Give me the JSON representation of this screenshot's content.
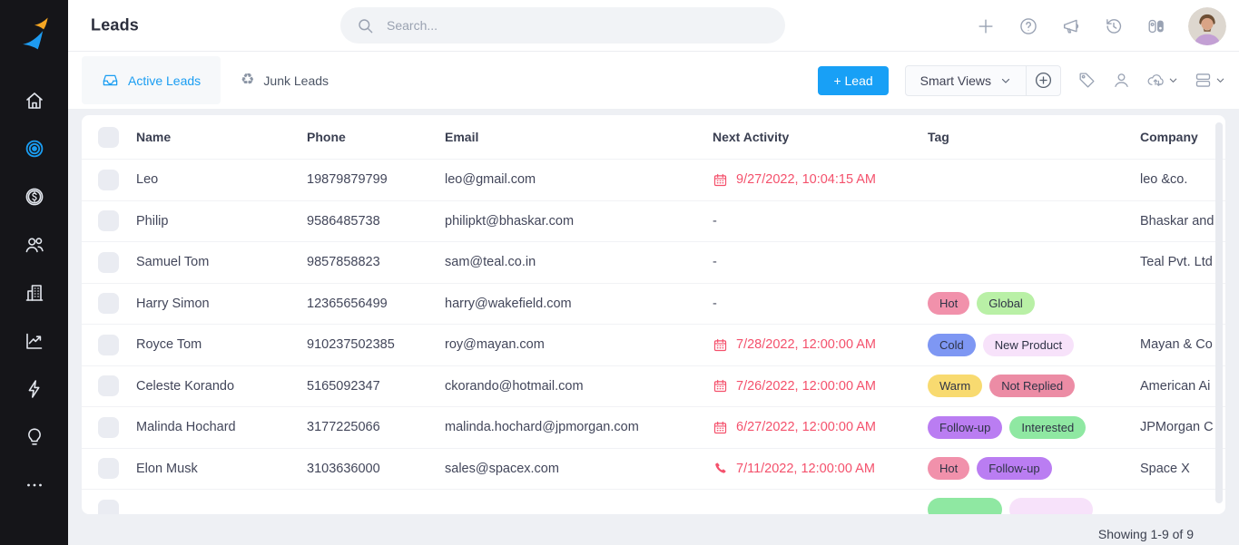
{
  "header": {
    "title": "Leads"
  },
  "search": {
    "placeholder": "Search..."
  },
  "topbar_icons": [
    {
      "name": "add-icon",
      "icon": "plus"
    },
    {
      "name": "help-icon",
      "icon": "help"
    },
    {
      "name": "announcements-icon",
      "icon": "megaphone"
    },
    {
      "name": "history-icon",
      "icon": "history"
    },
    {
      "name": "apps-icon",
      "icon": "apps"
    }
  ],
  "sidebar": {
    "items": [
      {
        "name": "sidebar-item-home",
        "icon": "home",
        "active": false
      },
      {
        "name": "sidebar-item-leads",
        "icon": "target",
        "active": true
      },
      {
        "name": "sidebar-item-deals",
        "icon": "dollar",
        "active": false
      },
      {
        "name": "sidebar-item-contacts",
        "icon": "people",
        "active": false
      },
      {
        "name": "sidebar-item-companies",
        "icon": "building",
        "active": false
      },
      {
        "name": "sidebar-item-reports",
        "icon": "chart",
        "active": false
      },
      {
        "name": "sidebar-item-workflows",
        "icon": "bolt",
        "active": false
      },
      {
        "name": "sidebar-item-insights",
        "icon": "bulb",
        "active": false
      },
      {
        "name": "sidebar-item-more",
        "icon": "dots",
        "active": false
      }
    ]
  },
  "tabs": [
    {
      "label": "Active Leads",
      "icon": "inbox",
      "active": true
    },
    {
      "label": "Junk Leads",
      "icon": "recycle",
      "active": false
    }
  ],
  "toolbar": {
    "add_lead_label": "+ Lead",
    "smart_views_label": "Smart Views",
    "icons": [
      {
        "name": "tag-icon",
        "icon": "tag",
        "chevron": false
      },
      {
        "name": "assign-user-icon",
        "icon": "person",
        "chevron": false
      },
      {
        "name": "cloud-sync-icon",
        "icon": "cloud",
        "chevron": true
      },
      {
        "name": "layout-rows-icon",
        "icon": "rows",
        "chevron": true
      }
    ]
  },
  "colors": {
    "accent_blue": "#18a0f6",
    "activity_red": "#f4516c",
    "tag_hot": "#f191ab",
    "tag_global": "#b9f0a6",
    "tag_cold": "#7e97f3",
    "tag_new_product": "#f7e2fa",
    "tag_warm": "#f8da70",
    "tag_not_replied": "#ec8ca5",
    "tag_follow_up": "#ba7df2",
    "tag_interested": "#8fe8a2"
  },
  "table": {
    "columns": [
      "Name",
      "Phone",
      "Email",
      "Next Activity",
      "Tag",
      "Company"
    ],
    "rows": [
      {
        "name": "Leo",
        "phone": "19879879799",
        "email": "leo@gmail.com",
        "next_activity": {
          "icon": "calendar",
          "text": "9/27/2022, 10:04:15 AM"
        },
        "tags": [],
        "company": "leo &co."
      },
      {
        "name": "Philip",
        "phone": "9586485738",
        "email": "philipkt@bhaskar.com",
        "next_activity": null,
        "tags": [],
        "company": "Bhaskar and"
      },
      {
        "name": "Samuel Tom",
        "phone": "9857858823",
        "email": "sam@teal.co.in",
        "next_activity": null,
        "tags": [],
        "company": "Teal Pvt. Ltd"
      },
      {
        "name": "Harry Simon",
        "phone": "12365656499",
        "email": "harry@wakefield.com",
        "next_activity": null,
        "tags": [
          {
            "label": "Hot",
            "color": "#f191ab"
          },
          {
            "label": "Global",
            "color": "#b9f0a6"
          }
        ],
        "company": ""
      },
      {
        "name": "Royce Tom",
        "phone": "910237502385",
        "email": "roy@mayan.com",
        "next_activity": {
          "icon": "calendar",
          "text": "7/28/2022, 12:00:00 AM"
        },
        "tags": [
          {
            "label": "Cold",
            "color": "#7e97f3"
          },
          {
            "label": "New Product",
            "color": "#f7e2fa"
          }
        ],
        "company": "Mayan & Co"
      },
      {
        "name": "Celeste Korando",
        "phone": "5165092347",
        "email": "ckorando@hotmail.com",
        "next_activity": {
          "icon": "calendar",
          "text": "7/26/2022, 12:00:00 AM"
        },
        "tags": [
          {
            "label": "Warm",
            "color": "#f8da70"
          },
          {
            "label": "Not Replied",
            "color": "#ec8ca5"
          }
        ],
        "company": "American Ai"
      },
      {
        "name": "Malinda Hochard",
        "phone": "3177225066",
        "email": "malinda.hochard@jpmorgan.com",
        "next_activity": {
          "icon": "calendar",
          "text": "6/27/2022, 12:00:00 AM"
        },
        "tags": [
          {
            "label": "Follow-up",
            "color": "#ba7df2"
          },
          {
            "label": "Interested",
            "color": "#8fe8a2"
          }
        ],
        "company": "JPMorgan C"
      },
      {
        "name": "Elon Musk",
        "phone": "3103636000",
        "email": "sales@spacex.com",
        "next_activity": {
          "icon": "phone",
          "text": "7/11/2022, 12:00:00 AM"
        },
        "tags": [
          {
            "label": "Hot",
            "color": "#f191ab"
          },
          {
            "label": "Follow-up",
            "color": "#ba7df2"
          }
        ],
        "company": "Space X"
      },
      {
        "name": "",
        "phone": "",
        "email": "",
        "partial": true,
        "next_activity": {
          "icon": "none",
          "text": ""
        },
        "tags": [
          {
            "label": "",
            "color": "#8fe8a2",
            "empty": "empty-g"
          },
          {
            "label": "",
            "color": "#f7e2fa",
            "empty": "empty-l"
          }
        ],
        "company": ""
      }
    ],
    "showing": "Showing 1-9 of 9"
  }
}
